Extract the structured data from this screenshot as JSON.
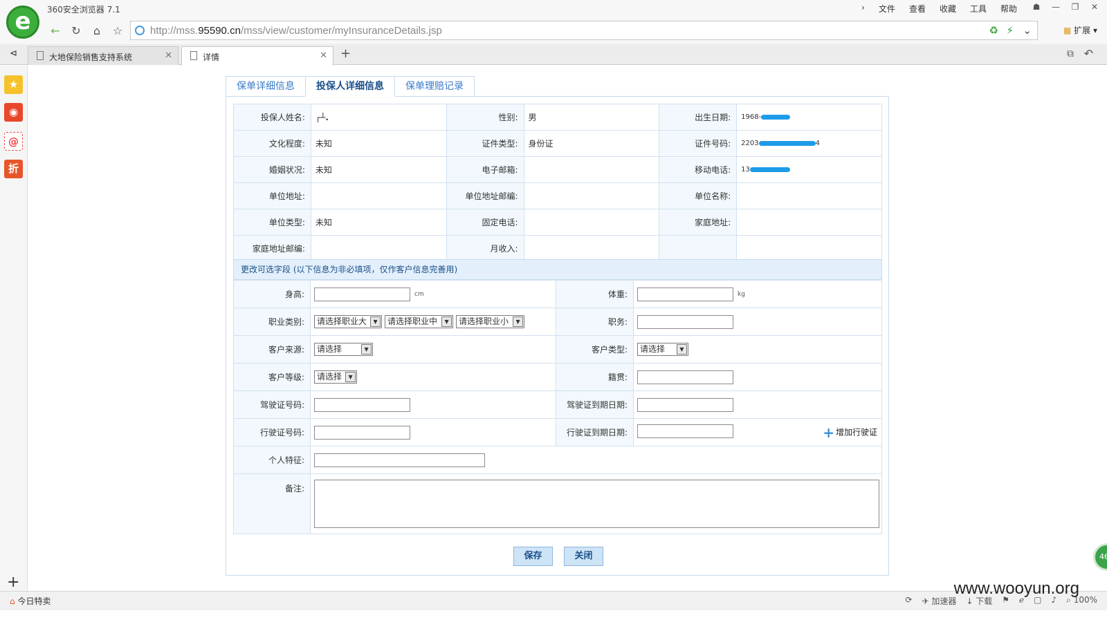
{
  "browser": {
    "app_title": "360安全浏览器 7.1",
    "menus": [
      "文件",
      "查看",
      "收藏",
      "工具",
      "帮助"
    ],
    "url_prefix": "http://mss.",
    "url_domain": "95590.cn",
    "url_path": "/mss/view/customer/myInsuranceDetails.jsp",
    "extension_label": "扩展",
    "tabs": [
      {
        "title": "大地保险销售支持系统"
      },
      {
        "title": "详情"
      }
    ],
    "status_left": "今日特卖",
    "status_accelerator": "加速器",
    "status_download": "下载",
    "zoom": "100%",
    "float_badge": "46",
    "watermark": "www.wooyun.org"
  },
  "page": {
    "tabs": [
      "保单详细信息",
      "投保人详细信息",
      "保单理赔记录"
    ],
    "active_tab": 1,
    "info": {
      "name_label": "投保人姓名:",
      "name_value": "┌┴.",
      "gender_label": "性别:",
      "gender_value": "男",
      "birth_label": "出生日期:",
      "birth_value": "1968-",
      "edu_label": "文化程度:",
      "edu_value": "未知",
      "idtype_label": "证件类型:",
      "idtype_value": "身份证",
      "idno_label": "证件号码:",
      "idno_value": "2203",
      "idno_suffix": "4",
      "marital_label": "婚姻状况:",
      "marital_value": "未知",
      "email_label": "电子邮箱:",
      "email_value": "",
      "mobile_label": "移动电话:",
      "mobile_value": "13",
      "workaddr_label": "单位地址:",
      "workaddr_value": "",
      "workzip_label": "单位地址邮编:",
      "workzip_value": "",
      "workname_label": "单位名称:",
      "workname_value": "",
      "worktype_label": "单位类型:",
      "worktype_value": "未知",
      "phone_label": "固定电话:",
      "phone_value": "",
      "homeaddr_label": "家庭地址:",
      "homeaddr_value": "",
      "homezip_label": "家庭地址邮编:",
      "homezip_value": "",
      "income_label": "月收入:",
      "income_value": ""
    },
    "section_title": "更改可选字段 (以下信息为非必填项，仅作客户信息完善用)",
    "form": {
      "height_label": "身高:",
      "height_unit": "cm",
      "weight_label": "体重:",
      "weight_unit": "kg",
      "occupation_label": "职业类别:",
      "occ_big": "请选择职业大",
      "occ_mid": "请选择职业中",
      "occ_small": "请选择职业小",
      "title_label": "职务:",
      "source_label": "客户来源:",
      "source_value": "请选择",
      "ctype_label": "客户类型:",
      "ctype_value": "请选择",
      "level_label": "客户等级:",
      "level_value": "请选择",
      "native_label": "籍贯:",
      "license_label": "驾驶证号码:",
      "license_exp_label": "驾驶证到期日期:",
      "vlicense_label": "行驶证号码:",
      "vlicense_exp_label": "行驶证到期日期:",
      "add_vlicense": "增加行驶证",
      "feature_label": "个人特征:",
      "remark_label": "备注:"
    },
    "buttons": {
      "save": "保存",
      "close": "关闭"
    }
  }
}
